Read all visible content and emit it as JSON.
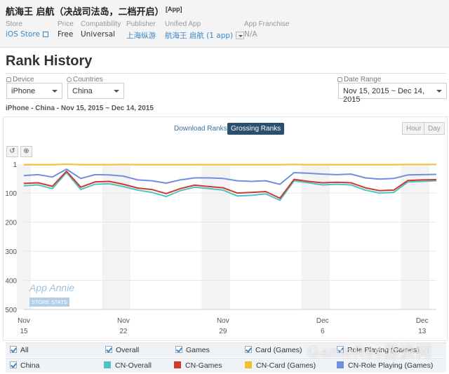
{
  "app": {
    "title": "航海王 启航（决战司法岛，二档开启）",
    "tag": "[App]"
  },
  "meta": [
    {
      "key": "Store",
      "value": "iOS Store"
    },
    {
      "key": "Price",
      "value": "Free"
    },
    {
      "key": "Compatibility",
      "value": "Universal"
    },
    {
      "key": "Publisher",
      "value": "上海纵游"
    },
    {
      "key": "Unified App",
      "value": "航海王 启航 (1 app)"
    },
    {
      "key": "App Franchise",
      "value": "N/A"
    }
  ],
  "page_title": "Rank History",
  "controls": {
    "device_label": "Device",
    "device_value": "iPhone",
    "countries_label": "Countries",
    "countries_value": "China",
    "date_label": "Date Range",
    "date_value": "Nov 15, 2015 ~ Dec 14, 2015"
  },
  "subhead": "iPhone - China - Nov 15, 2015 ~ Dec 14, 2015",
  "rank_tabs": {
    "download": "Download Ranks",
    "grossing": "Grossing Ranks"
  },
  "granularity": {
    "hour": "Hour",
    "day": "Day"
  },
  "tools": {
    "reset": "↺",
    "zoom": "⊕"
  },
  "watermark_logo": {
    "name": "App Annie",
    "tag": "STORE STATS"
  },
  "site_watermark": "GameRes游资网",
  "legend_filters": [
    "All",
    "Overall",
    "Games",
    "Card (Games)",
    "Role Playing (Games)"
  ],
  "legend_series_lead": "China",
  "colors": {
    "cn_overall": "#4bc3c8",
    "cn_games": "#cc3b2b",
    "cn_card": "#f0c030",
    "cn_role": "#6f8fe0"
  },
  "chart_data": {
    "type": "line",
    "y_reversed": true,
    "ylim": [
      1,
      500
    ],
    "yticks": [
      "1",
      "100",
      "200",
      "300",
      "400",
      "500"
    ],
    "xticks": [
      {
        "top": "Nov",
        "bottom": "15"
      },
      {
        "top": "Nov",
        "bottom": "22"
      },
      {
        "top": "Nov",
        "bottom": "29"
      },
      {
        "top": "Dec",
        "bottom": "6"
      },
      {
        "top": "Dec",
        "bottom": "13"
      }
    ],
    "x": [
      "Nov 15",
      "Nov 16",
      "Nov 17",
      "Nov 18",
      "Nov 19",
      "Nov 20",
      "Nov 21",
      "Nov 22",
      "Nov 23",
      "Nov 24",
      "Nov 25",
      "Nov 26",
      "Nov 27",
      "Nov 28",
      "Nov 29",
      "Nov 30",
      "Dec 1",
      "Dec 2",
      "Dec 3",
      "Dec 4",
      "Dec 5",
      "Dec 6",
      "Dec 7",
      "Dec 8",
      "Dec 9",
      "Dec 10",
      "Dec 11",
      "Dec 12",
      "Dec 13",
      "Dec 14"
    ],
    "series": [
      {
        "name": "CN-Overall",
        "color": "#4bc3c8",
        "values": [
          75,
          72,
          85,
          30,
          88,
          70,
          68,
          78,
          90,
          98,
          112,
          92,
          80,
          85,
          90,
          110,
          108,
          103,
          125,
          58,
          65,
          72,
          70,
          72,
          90,
          100,
          98,
          62,
          60,
          58
        ]
      },
      {
        "name": "CN-Games",
        "color": "#cc3b2b",
        "values": [
          67,
          65,
          77,
          25,
          80,
          62,
          60,
          70,
          83,
          88,
          102,
          85,
          73,
          78,
          82,
          100,
          98,
          95,
          118,
          53,
          60,
          65,
          63,
          65,
          82,
          92,
          90,
          57,
          55,
          54
        ]
      },
      {
        "name": "CN-Card (Games)",
        "color": "#f0c030",
        "values": [
          3,
          3,
          3,
          1,
          3,
          3,
          3,
          2,
          3,
          3,
          3,
          3,
          3,
          3,
          3,
          3,
          3,
          3,
          3,
          2,
          3,
          3,
          3,
          3,
          3,
          3,
          3,
          2,
          2,
          2
        ]
      },
      {
        "name": "CN-Role Playing (Games)",
        "color": "#6f8fe0",
        "values": [
          40,
          37,
          45,
          18,
          50,
          37,
          38,
          42,
          55,
          58,
          66,
          55,
          48,
          48,
          50,
          58,
          60,
          58,
          70,
          30,
          32,
          35,
          37,
          35,
          48,
          52,
          50,
          38,
          37,
          36
        ]
      }
    ]
  }
}
